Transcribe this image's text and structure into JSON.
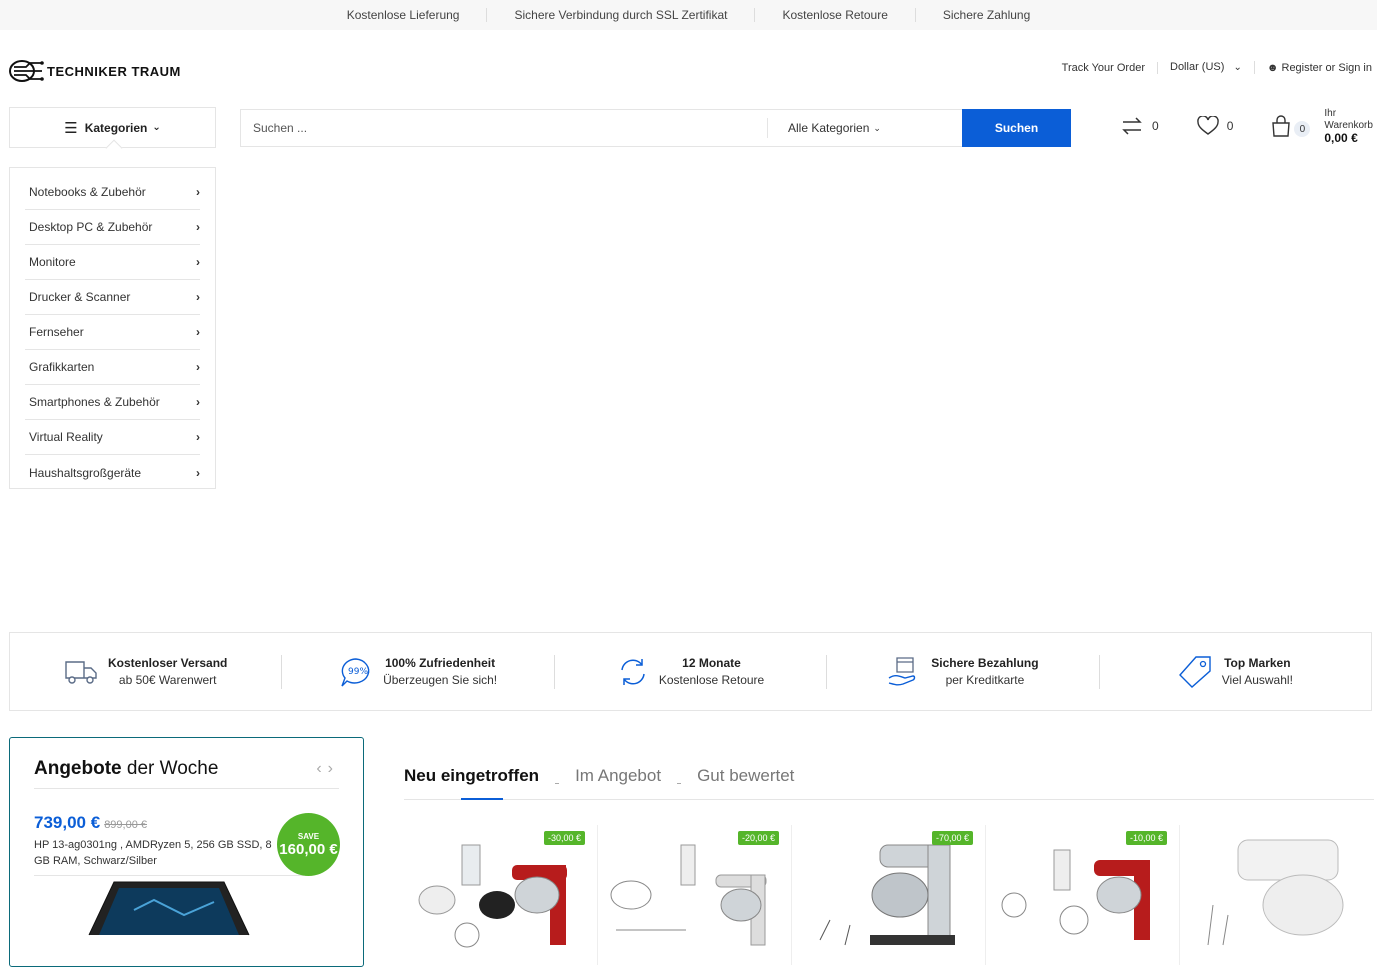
{
  "topbar": [
    "Kostenlose Lieferung",
    "Sichere Verbindung durch SSL Zertifikat",
    "Kostenlose Retoure",
    "Sichere Zahlung"
  ],
  "logo": {
    "text": "TECHNIKER TRAUM"
  },
  "header_links": {
    "track": "Track Your Order",
    "currency": "Dollar (US)",
    "account": "Register or Sign in"
  },
  "categories": {
    "button_label": "Kategorien",
    "items": [
      "Notebooks & Zubehör",
      "Desktop PC & Zubehör",
      "Monitore",
      "Drucker & Scanner",
      "Fernseher",
      "Grafikkarten",
      "Smartphones & Zubehör",
      "Virtual Reality",
      "Haushaltsgroßgeräte"
    ]
  },
  "search": {
    "placeholder": "Suchen ...",
    "category": "Alle Kategorien",
    "button": "Suchen"
  },
  "counters": {
    "compare": "0",
    "wishlist": "0",
    "cart_count": "0",
    "cart_label_1": "Ihr",
    "cart_label_2": "Warenkorb",
    "cart_total": "0,00 €"
  },
  "features": [
    {
      "title": "Kostenloser Versand",
      "sub": "ab 50€ Warenwert",
      "icon": "truck-icon"
    },
    {
      "title": "100% Zufriedenheit",
      "sub": "Überzeugen Sie sich!",
      "icon": "satisfaction-icon"
    },
    {
      "title": "12 Monate",
      "sub": "Kostenlose Retoure",
      "icon": "refresh-icon"
    },
    {
      "title": "Sichere Bezahlung",
      "sub": "per Kreditkarte",
      "icon": "payment-icon"
    },
    {
      "title": "Top Marken",
      "sub": "Viel Auswahl!",
      "icon": "tag-icon"
    }
  ],
  "deals": {
    "title_bold": "Angebote",
    "title_rest": " der Woche",
    "price": "739,00 €",
    "old_price": "899,00 €",
    "product": "HP 13-ag0301ng , AMDRyzen 5, 256 GB SSD, 8 GB RAM, Schwarz/Silber",
    "save_label": "SAVE",
    "save_amount": "160,00 €"
  },
  "tabs": [
    "Neu eingetroffen",
    "Im Angebot",
    "Gut bewertet"
  ],
  "products": [
    {
      "discount": "-30,00 €"
    },
    {
      "discount": "-20,00 €"
    },
    {
      "discount": "-70,00 €"
    },
    {
      "discount": "-10,00 €"
    },
    {
      "discount": ""
    }
  ],
  "colors": {
    "accent": "#0b5ed7",
    "sale": "#55b52a"
  }
}
